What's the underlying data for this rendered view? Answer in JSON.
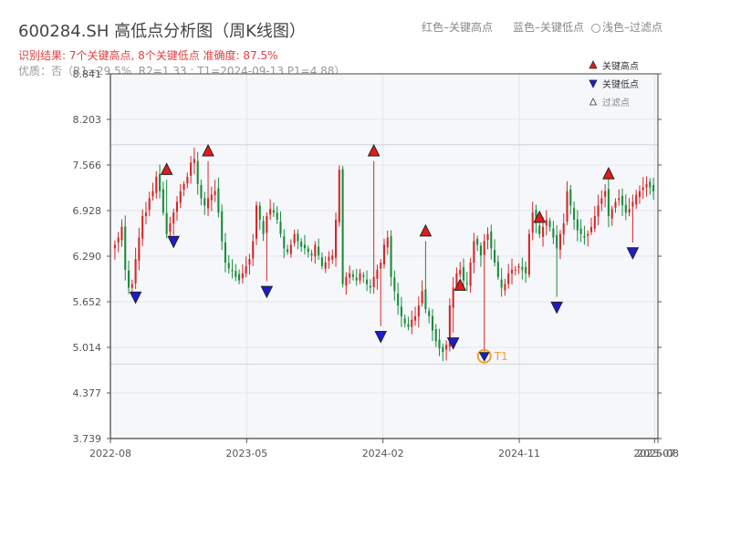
{
  "header": {
    "title": "600284.SH 高低点分析图（周K线图）",
    "legend_red": "红色–关键高点",
    "legend_blue": "蓝色–关键低点",
    "legend_filtered": "浅色–过滤点",
    "result": "识别结果: 7个关键高点, 8个关键低点   准确度: 87.5%",
    "meta": "优质：否（R1=29.5%, R2=1.33 ; T1=2024-09-13 P1=4.88）"
  },
  "colors": {
    "up": "#d62728",
    "down": "#1a8c3c",
    "high_marker": "#e21b1b",
    "low_marker": "#1c1ccf",
    "t1_ring": "#f0a030",
    "plot_bg": "#f5f7fa",
    "grid": "#e2e5ea"
  },
  "chart_data": {
    "type": "candlestick",
    "title": "600284.SH 高低点分析图（周K线图）",
    "y_ticks": [
      "3.739",
      "4.377",
      "5.014",
      "5.652",
      "6.290",
      "6.928",
      "7.566",
      "8.203",
      "8.841"
    ],
    "ylim": [
      3.739,
      8.841
    ],
    "x_ticks": [
      "2022-08",
      "2023-05",
      "2024-02",
      "2024-11",
      "2025-07",
      "2025-08"
    ],
    "grid": true,
    "reference_lines": [
      7.85,
      4.78
    ],
    "legend": {
      "position": "top-right",
      "entries": [
        "关键高点",
        "关键低点",
        "过滤点"
      ]
    },
    "weeks": 157,
    "closes_approx": [
      6.45,
      6.55,
      6.7,
      6.1,
      5.85,
      5.9,
      6.25,
      6.55,
      6.85,
      6.9,
      7.1,
      7.2,
      7.4,
      7.2,
      6.9,
      6.6,
      6.75,
      6.9,
      7.05,
      7.2,
      7.3,
      7.4,
      7.6,
      7.65,
      7.3,
      7.1,
      7.0,
      7.1,
      7.15,
      7.2,
      6.9,
      6.5,
      6.2,
      6.12,
      6.08,
      6.0,
      5.95,
      6.05,
      6.15,
      6.25,
      6.5,
      7.0,
      6.8,
      6.6,
      6.85,
      6.95,
      6.9,
      6.8,
      6.6,
      6.4,
      6.35,
      6.45,
      6.6,
      6.5,
      6.42,
      6.4,
      6.35,
      6.3,
      6.45,
      6.3,
      6.15,
      6.2,
      6.28,
      6.3,
      6.8,
      7.5,
      5.9,
      6.0,
      6.05,
      6.0,
      5.95,
      6.05,
      6.0,
      5.9,
      5.85,
      6.0,
      6.1,
      6.2,
      6.45,
      6.55,
      6.0,
      5.8,
      5.6,
      5.45,
      5.35,
      5.3,
      5.4,
      5.45,
      5.6,
      5.8,
      5.55,
      5.45,
      5.25,
      5.1,
      5.0,
      4.95,
      5.05,
      5.6,
      5.85,
      6.05,
      6.1,
      5.95,
      5.9,
      6.2,
      6.5,
      6.45,
      6.3,
      6.5,
      6.6,
      6.4,
      6.2,
      6.0,
      5.85,
      5.9,
      6.05,
      6.1,
      6.1,
      6.15,
      6.1,
      6.05,
      6.6,
      6.9,
      6.75,
      6.6,
      6.7,
      6.8,
      6.7,
      6.55,
      6.4,
      6.6,
      6.75,
      7.2,
      7.0,
      6.8,
      6.65,
      6.6,
      6.55,
      6.6,
      6.7,
      6.85,
      7.0,
      7.1,
      7.2,
      6.85,
      6.95,
      7.05,
      7.1,
      7.0,
      6.9,
      6.95,
      7.05,
      7.15,
      7.2,
      7.25,
      7.3,
      7.25,
      7.2
    ],
    "key_highs": [
      {
        "week": 15,
        "price": 7.42
      },
      {
        "week": 27,
        "price": 7.68
      },
      {
        "week": 75,
        "price": 7.68
      },
      {
        "week": 90,
        "price": 6.56
      },
      {
        "week": 100,
        "price": 5.8
      },
      {
        "week": 123,
        "price": 6.75
      },
      {
        "week": 143,
        "price": 7.36
      }
    ],
    "key_lows": [
      {
        "week": 6,
        "price": 5.8
      },
      {
        "week": 17,
        "price": 6.58
      },
      {
        "week": 44,
        "price": 5.88
      },
      {
        "week": 77,
        "price": 5.25
      },
      {
        "week": 98,
        "price": 5.16
      },
      {
        "week": 107,
        "price": 4.89,
        "label": "T1"
      },
      {
        "week": 128,
        "price": 5.66
      },
      {
        "week": 150,
        "price": 6.42
      }
    ],
    "t1_label": "T1"
  }
}
